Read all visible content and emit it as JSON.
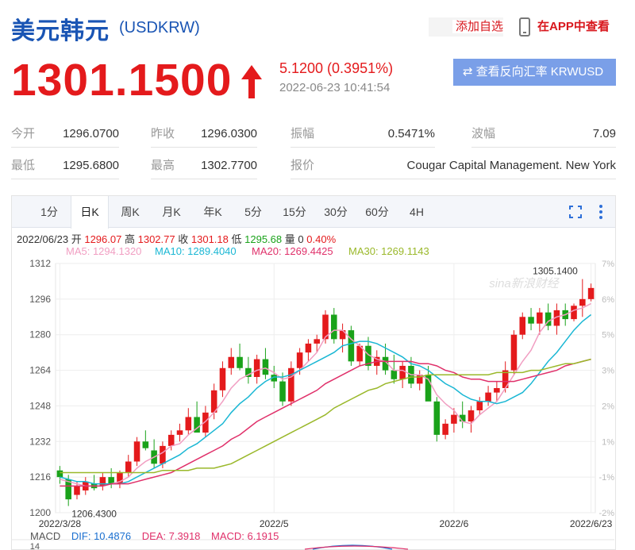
{
  "header": {
    "title_cn": "美元韩元",
    "code": "(USDKRW)",
    "add_watchlist": "添加自选",
    "view_in_app": "在APP中查看"
  },
  "quote": {
    "price": "1301.1500",
    "change": "5.1200 (0.3951%)",
    "timestamp": "2022-06-23 10:41:54",
    "reverse_button": "查看反向汇率 KRWUSD",
    "rows": [
      [
        {
          "label": "今开",
          "value": "1296.0700"
        },
        {
          "label": "昨收",
          "value": "1296.0300"
        },
        {
          "label": "振幅",
          "value": "0.5471%"
        },
        {
          "label": "波幅",
          "value": "7.09"
        }
      ],
      [
        {
          "label": "最低",
          "value": "1295.6800"
        },
        {
          "label": "最高",
          "value": "1302.7700"
        },
        {
          "label": "报价",
          "value": "Cougar Capital Management. New York"
        }
      ]
    ]
  },
  "tabs": [
    "1分",
    "日K",
    "周K",
    "月K",
    "年K",
    "5分",
    "15分",
    "30分",
    "60分",
    "4H"
  ],
  "active_tab": "日K",
  "ohlc": {
    "date": "2022/06/23",
    "open_label": "开",
    "open": "1296.07",
    "high_label": "高",
    "high": "1302.77",
    "close_label": "收",
    "close": "1301.18",
    "low_label": "低",
    "low": "1295.68",
    "vol_label": "量",
    "vol": "0",
    "pct": "0.40%"
  },
  "ma": {
    "ma5": "MA5: 1294.1320",
    "ma10": "MA10: 1289.4040",
    "ma20": "MA20: 1269.4425",
    "ma30": "MA30: 1269.1143"
  },
  "colors": {
    "up": "#e41a1c",
    "down": "#1aa21a",
    "ma5": "#f19ec2",
    "ma10": "#1ab7d4",
    "ma20": "#e0306a",
    "ma30": "#9ab82a",
    "accent": "#1a55b4"
  },
  "macd": {
    "label": "MACD",
    "dif": "DIF: 10.4876",
    "dea": "DEA: 7.3918",
    "macd": "MACD: 6.1915",
    "axis_tick": "14"
  },
  "chart_data": {
    "type": "candlestick",
    "ylim": [
      1200,
      1312
    ],
    "y_ticks": [
      1200,
      1216,
      1232,
      1248,
      1264,
      1280,
      1296,
      1312
    ],
    "y_tick_labels": [
      "1200",
      "1216",
      "1232",
      "1248",
      "1264",
      "1280",
      "1296",
      "1312"
    ],
    "pct_tick_labels": [
      "-2%",
      "-1%",
      "1%",
      "2%",
      "3%",
      "5%",
      "6%",
      "7%"
    ],
    "pct_tick_values": [
      1200,
      1216,
      1232,
      1248,
      1264,
      1280,
      1296,
      1312
    ],
    "x_labels": [
      {
        "index": 0,
        "label": "2022/3/28"
      },
      {
        "index": 25,
        "label": "2022/5"
      },
      {
        "index": 46,
        "label": "2022/6"
      },
      {
        "index": 62,
        "label": "2022/6/23"
      }
    ],
    "max_label": "1305.1400",
    "min_label": "1206.4300",
    "watermark": "sina新浪财经",
    "candles": [
      {
        "o": 1219,
        "h": 1221,
        "l": 1213,
        "c": 1216
      },
      {
        "o": 1215,
        "h": 1217,
        "l": 1203,
        "c": 1206
      },
      {
        "o": 1208,
        "h": 1214,
        "l": 1206,
        "c": 1212
      },
      {
        "o": 1210,
        "h": 1216,
        "l": 1208,
        "c": 1214
      },
      {
        "o": 1213,
        "h": 1217,
        "l": 1210,
        "c": 1211
      },
      {
        "o": 1212,
        "h": 1218,
        "l": 1210,
        "c": 1216
      },
      {
        "o": 1216,
        "h": 1220,
        "l": 1211,
        "c": 1213
      },
      {
        "o": 1213,
        "h": 1219,
        "l": 1211,
        "c": 1218
      },
      {
        "o": 1218,
        "h": 1226,
        "l": 1216,
        "c": 1223
      },
      {
        "o": 1223,
        "h": 1234,
        "l": 1221,
        "c": 1232
      },
      {
        "o": 1232,
        "h": 1237,
        "l": 1228,
        "c": 1229
      },
      {
        "o": 1228,
        "h": 1233,
        "l": 1220,
        "c": 1222
      },
      {
        "o": 1222,
        "h": 1232,
        "l": 1220,
        "c": 1230
      },
      {
        "o": 1230,
        "h": 1237,
        "l": 1228,
        "c": 1235
      },
      {
        "o": 1235,
        "h": 1240,
        "l": 1232,
        "c": 1237
      },
      {
        "o": 1237,
        "h": 1247,
        "l": 1235,
        "c": 1243
      },
      {
        "o": 1243,
        "h": 1250,
        "l": 1240,
        "c": 1236
      },
      {
        "o": 1236,
        "h": 1248,
        "l": 1234,
        "c": 1245
      },
      {
        "o": 1245,
        "h": 1258,
        "l": 1242,
        "c": 1255
      },
      {
        "o": 1255,
        "h": 1268,
        "l": 1252,
        "c": 1265
      },
      {
        "o": 1265,
        "h": 1274,
        "l": 1262,
        "c": 1270
      },
      {
        "o": 1270,
        "h": 1276,
        "l": 1264,
        "c": 1265
      },
      {
        "o": 1265,
        "h": 1270,
        "l": 1258,
        "c": 1261
      },
      {
        "o": 1261,
        "h": 1271,
        "l": 1258,
        "c": 1269
      },
      {
        "o": 1269,
        "h": 1274,
        "l": 1260,
        "c": 1262
      },
      {
        "o": 1262,
        "h": 1266,
        "l": 1256,
        "c": 1259
      },
      {
        "o": 1259,
        "h": 1263,
        "l": 1248,
        "c": 1250
      },
      {
        "o": 1250,
        "h": 1268,
        "l": 1248,
        "c": 1265
      },
      {
        "o": 1265,
        "h": 1274,
        "l": 1262,
        "c": 1272
      },
      {
        "o": 1272,
        "h": 1278,
        "l": 1268,
        "c": 1276
      },
      {
        "o": 1276,
        "h": 1280,
        "l": 1272,
        "c": 1278
      },
      {
        "o": 1278,
        "h": 1291,
        "l": 1276,
        "c": 1289
      },
      {
        "o": 1289,
        "h": 1292,
        "l": 1276,
        "c": 1278
      },
      {
        "o": 1278,
        "h": 1285,
        "l": 1272,
        "c": 1282
      },
      {
        "o": 1282,
        "h": 1284,
        "l": 1266,
        "c": 1268
      },
      {
        "o": 1268,
        "h": 1276,
        "l": 1266,
        "c": 1275
      },
      {
        "o": 1275,
        "h": 1279,
        "l": 1264,
        "c": 1266
      },
      {
        "o": 1266,
        "h": 1273,
        "l": 1262,
        "c": 1270
      },
      {
        "o": 1270,
        "h": 1276,
        "l": 1262,
        "c": 1264
      },
      {
        "o": 1264,
        "h": 1271,
        "l": 1258,
        "c": 1260
      },
      {
        "o": 1260,
        "h": 1268,
        "l": 1256,
        "c": 1266
      },
      {
        "o": 1266,
        "h": 1270,
        "l": 1256,
        "c": 1258
      },
      {
        "o": 1258,
        "h": 1264,
        "l": 1255,
        "c": 1262
      },
      {
        "o": 1262,
        "h": 1266,
        "l": 1252,
        "c": 1250
      },
      {
        "o": 1250,
        "h": 1252,
        "l": 1232,
        "c": 1235
      },
      {
        "o": 1235,
        "h": 1242,
        "l": 1233,
        "c": 1240
      },
      {
        "o": 1240,
        "h": 1247,
        "l": 1236,
        "c": 1244
      },
      {
        "o": 1244,
        "h": 1250,
        "l": 1238,
        "c": 1241
      },
      {
        "o": 1241,
        "h": 1248,
        "l": 1236,
        "c": 1246
      },
      {
        "o": 1246,
        "h": 1252,
        "l": 1244,
        "c": 1250
      },
      {
        "o": 1250,
        "h": 1257,
        "l": 1248,
        "c": 1254
      },
      {
        "o": 1254,
        "h": 1259,
        "l": 1250,
        "c": 1256
      },
      {
        "o": 1256,
        "h": 1268,
        "l": 1254,
        "c": 1264
      },
      {
        "o": 1264,
        "h": 1282,
        "l": 1262,
        "c": 1280
      },
      {
        "o": 1280,
        "h": 1290,
        "l": 1278,
        "c": 1288
      },
      {
        "o": 1288,
        "h": 1292,
        "l": 1282,
        "c": 1285
      },
      {
        "o": 1285,
        "h": 1292,
        "l": 1280,
        "c": 1290
      },
      {
        "o": 1290,
        "h": 1294,
        "l": 1282,
        "c": 1284
      },
      {
        "o": 1284,
        "h": 1294,
        "l": 1280,
        "c": 1291
      },
      {
        "o": 1291,
        "h": 1294,
        "l": 1284,
        "c": 1287
      },
      {
        "o": 1287,
        "h": 1294,
        "l": 1286,
        "c": 1293
      },
      {
        "o": 1293,
        "h": 1305,
        "l": 1288,
        "c": 1296
      },
      {
        "o": 1296,
        "h": 1303,
        "l": 1295,
        "c": 1301
      }
    ],
    "series": [
      {
        "name": "MA5",
        "values": [
          1215,
          1214,
          1213,
          1212,
          1212,
          1212,
          1213,
          1214,
          1216,
          1220,
          1223,
          1225,
          1227,
          1230,
          1231,
          1235,
          1238,
          1241,
          1245,
          1250,
          1256,
          1260,
          1262,
          1264,
          1265,
          1263,
          1260,
          1261,
          1264,
          1268,
          1272,
          1279,
          1282,
          1282,
          1278,
          1275,
          1271,
          1269,
          1268,
          1264,
          1264,
          1262,
          1262,
          1260,
          1253,
          1249,
          1246,
          1241,
          1240,
          1244,
          1247,
          1250,
          1256,
          1262,
          1268,
          1273,
          1281,
          1286,
          1288,
          1289,
          1291,
          1292,
          1294
        ]
      },
      {
        "name": "MA10",
        "values": [
          1216,
          1215,
          1214,
          1214,
          1213,
          1213,
          1213,
          1213,
          1214,
          1216,
          1218,
          1220,
          1222,
          1224,
          1226,
          1229,
          1231,
          1234,
          1237,
          1240,
          1245,
          1249,
          1252,
          1256,
          1259,
          1261,
          1261,
          1262,
          1264,
          1266,
          1268,
          1270,
          1272,
          1275,
          1276,
          1277,
          1277,
          1276,
          1274,
          1272,
          1270,
          1267,
          1266,
          1264,
          1261,
          1258,
          1256,
          1253,
          1251,
          1250,
          1250,
          1249,
          1250,
          1252,
          1254,
          1258,
          1263,
          1268,
          1272,
          1277,
          1282,
          1286,
          1289
        ]
      },
      {
        "name": "MA20",
        "values": [
          1212,
          1212,
          1212,
          1212,
          1212,
          1212,
          1213,
          1213,
          1213,
          1214,
          1215,
          1216,
          1217,
          1218,
          1220,
          1222,
          1224,
          1226,
          1228,
          1230,
          1233,
          1235,
          1238,
          1241,
          1243,
          1245,
          1247,
          1249,
          1251,
          1253,
          1255,
          1258,
          1260,
          1262,
          1264,
          1266,
          1267,
          1268,
          1268,
          1268,
          1268,
          1268,
          1267,
          1267,
          1266,
          1264,
          1263,
          1261,
          1260,
          1260,
          1259,
          1259,
          1259,
          1259,
          1260,
          1261,
          1262,
          1263,
          1264,
          1266,
          1267,
          1268,
          1269
        ]
      },
      {
        "name": "MA30",
        "values": [
          1218,
          1218,
          1218,
          1218,
          1218,
          1218,
          1218,
          1218,
          1218,
          1218,
          1218,
          1218,
          1219,
          1219,
          1219,
          1219,
          1220,
          1220,
          1220,
          1221,
          1222,
          1224,
          1226,
          1228,
          1230,
          1232,
          1234,
          1236,
          1238,
          1240,
          1242,
          1244,
          1247,
          1249,
          1251,
          1253,
          1255,
          1256,
          1258,
          1259,
          1260,
          1261,
          1261,
          1262,
          1262,
          1262,
          1262,
          1262,
          1262,
          1262,
          1262,
          1263,
          1263,
          1263,
          1263,
          1264,
          1264,
          1265,
          1266,
          1267,
          1267,
          1268,
          1269
        ]
      }
    ]
  }
}
